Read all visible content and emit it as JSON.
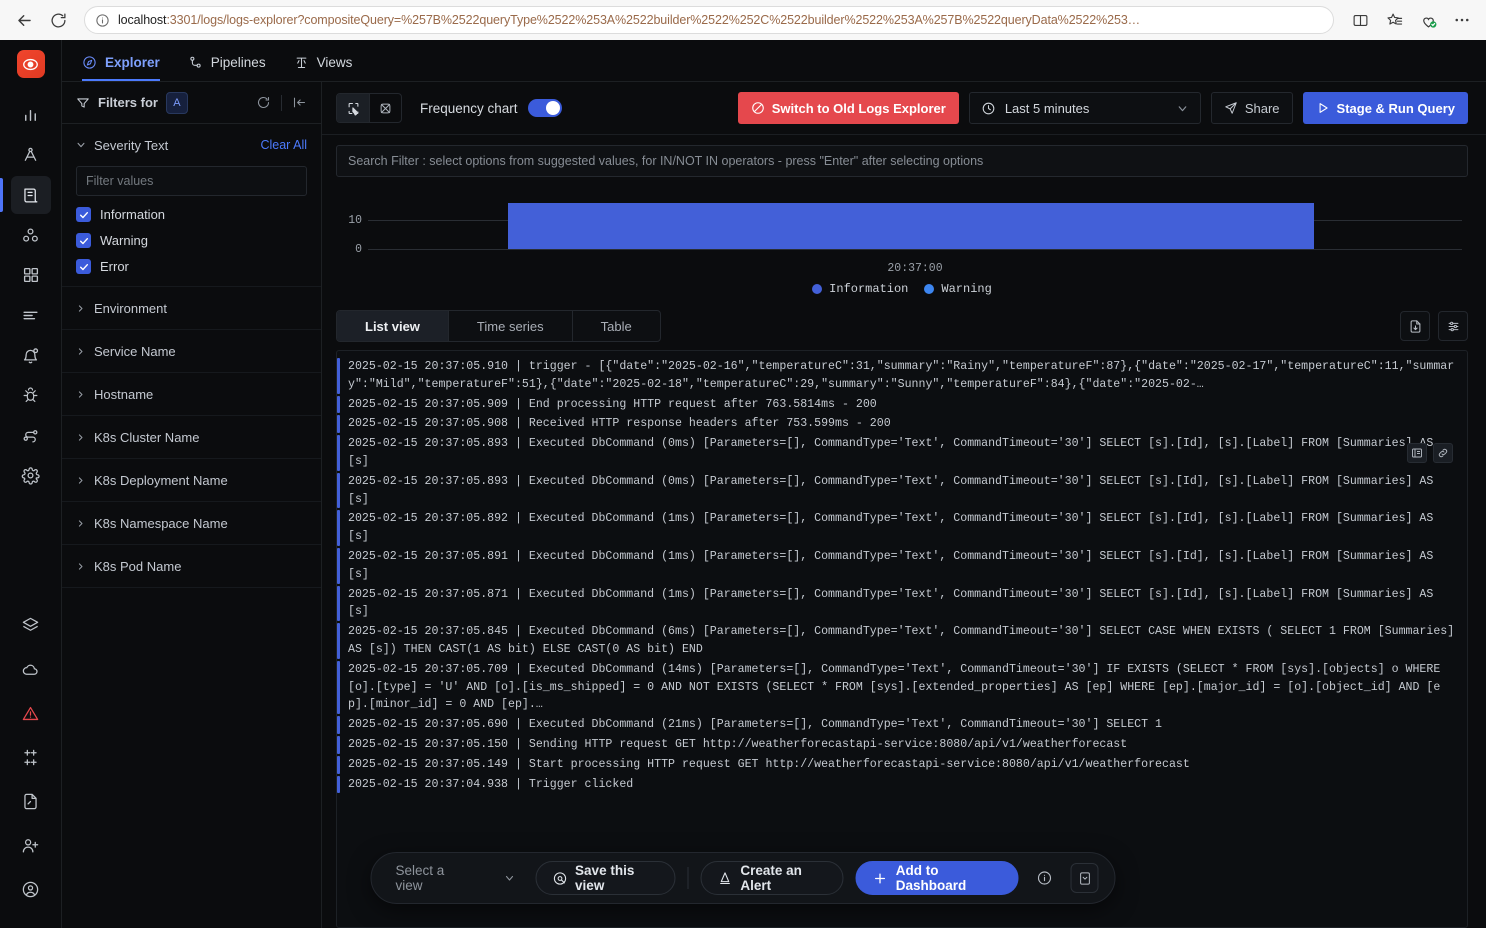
{
  "browser": {
    "back_icon": "back-arrow-icon",
    "reload_icon": "reload-icon",
    "url_host": "localhost",
    "url_rest": ":3301/logs/logs-explorer?compositeQuery=%257B%2522queryType%2522%253A%2522builder%2522%252C%2522builder%2522%253A%257B%2522queryData%2522%253…",
    "actions": [
      "split-screen-icon",
      "favorites-icon",
      "collections-icon",
      "more-icon"
    ]
  },
  "rail": {
    "logo_name": "signoz-logo",
    "items": [
      {
        "name": "services-icon",
        "active": false
      },
      {
        "name": "traces-icon",
        "active": false
      },
      {
        "name": "logs-icon",
        "active": true
      },
      {
        "name": "service-map-icon",
        "active": false
      },
      {
        "name": "dashboards-icon",
        "active": false
      },
      {
        "name": "messaging-queues-icon",
        "active": false
      },
      {
        "name": "alerts-icon",
        "active": false
      },
      {
        "name": "exceptions-icon",
        "active": false
      },
      {
        "name": "pipelines-icon",
        "active": false
      },
      {
        "name": "settings-icon",
        "active": false
      }
    ],
    "bottom_items": [
      {
        "name": "integrations-icon"
      },
      {
        "name": "cloud-icon"
      },
      {
        "name": "warning-icon"
      },
      {
        "name": "slack-icon"
      },
      {
        "name": "docs-icon"
      },
      {
        "name": "invite-member-icon"
      },
      {
        "name": "account-icon"
      }
    ]
  },
  "nav": {
    "tabs": [
      {
        "label": "Explorer",
        "icon": "explorer-icon",
        "active": true
      },
      {
        "label": "Pipelines",
        "icon": "pipelines-icon",
        "active": false
      },
      {
        "label": "Views",
        "icon": "views-icon",
        "active": false
      }
    ]
  },
  "filters": {
    "header_label": "Filters for",
    "query_chip": "A",
    "refresh_icon": "refresh-icon",
    "collapse_icon": "collapse-panel-icon",
    "severity": {
      "title": "Severity Text",
      "clear_all": "Clear All",
      "input_placeholder": "Filter values",
      "input_value": "",
      "options": [
        {
          "label": "Information",
          "checked": true
        },
        {
          "label": "Warning",
          "checked": true
        },
        {
          "label": "Error",
          "checked": true
        }
      ]
    },
    "collapsed_sections": [
      "Environment",
      "Service Name",
      "Hostname",
      "K8s Cluster Name",
      "K8s Deployment Name",
      "K8s Namespace Name",
      "K8s Pod Name"
    ]
  },
  "toolbar": {
    "view_mode_icons": [
      "select-view-icon",
      "raw-view-icon"
    ],
    "frequency_chart_label": "Frequency chart",
    "frequency_chart_on": true,
    "switch_old_label": "Switch to Old Logs Explorer",
    "switch_old_color": "#e5484d",
    "time_range": "Last 5 minutes",
    "share_label": "Share",
    "stage_run_label": "Stage & Run Query",
    "stage_run_color": "#3b5bdb"
  },
  "search": {
    "placeholder": "Search Filter : select options from suggested values, for IN/NOT IN operators - press \"Enter\" after selecting options",
    "value": ""
  },
  "chart_data": {
    "type": "bar",
    "title": "",
    "xlabel": "",
    "ylabel": "",
    "categories": [
      "20:37:00"
    ],
    "x": [
      "20:37:00"
    ],
    "series": [
      {
        "name": "Information",
        "values": [
          13
        ],
        "color": "#4360d8"
      },
      {
        "name": "Warning",
        "values": [
          0
        ],
        "color": "#3d86f0"
      }
    ],
    "ytick_labels": [
      "10",
      "0"
    ],
    "ylim": [
      0,
      13
    ],
    "grid": true,
    "legend_position": "bottom",
    "stacked": true
  },
  "views": {
    "tabs": [
      {
        "label": "List view",
        "active": true
      },
      {
        "label": "Time series",
        "active": false
      },
      {
        "label": "Table",
        "active": false
      }
    ],
    "right_buttons": [
      "download-icon",
      "options-icon"
    ]
  },
  "logs": {
    "hover_actions": [
      "log-details-icon",
      "copy-link-icon"
    ],
    "rows": [
      {
        "ts": "2025-02-15 20:37:05.910",
        "body": "trigger - [{\"date\":\"2025-02-16\",\"temperatureC\":31,\"summary\":\"Rainy\",\"temperatureF\":87},{\"date\":\"2025-02-17\",\"temperatureC\":11,\"summary\":\"Mild\",\"temperatureF\":51},{\"date\":\"2025-02-18\",\"temperatureC\":29,\"summary\":\"Sunny\",\"temperatureF\":84},{\"date\":\"2025-02-…"
      },
      {
        "ts": "2025-02-15 20:37:05.909",
        "body": "End processing HTTP request after 763.5814ms - 200"
      },
      {
        "ts": "2025-02-15 20:37:05.908",
        "body": "Received HTTP response headers after 753.599ms - 200"
      },
      {
        "ts": "2025-02-15 20:37:05.893",
        "body": "Executed DbCommand (0ms) [Parameters=[], CommandType='Text', CommandTimeout='30'] SELECT [s].[Id], [s].[Label] FROM [Summaries] AS [s]"
      },
      {
        "ts": "2025-02-15 20:37:05.893",
        "body": "Executed DbCommand (0ms) [Parameters=[], CommandType='Text', CommandTimeout='30'] SELECT [s].[Id], [s].[Label] FROM [Summaries] AS [s]"
      },
      {
        "ts": "2025-02-15 20:37:05.892",
        "body": "Executed DbCommand (1ms) [Parameters=[], CommandType='Text', CommandTimeout='30'] SELECT [s].[Id], [s].[Label] FROM [Summaries] AS [s]"
      },
      {
        "ts": "2025-02-15 20:37:05.891",
        "body": "Executed DbCommand (1ms) [Parameters=[], CommandType='Text', CommandTimeout='30'] SELECT [s].[Id], [s].[Label] FROM [Summaries] AS [s]"
      },
      {
        "ts": "2025-02-15 20:37:05.871",
        "body": "Executed DbCommand (1ms) [Parameters=[], CommandType='Text', CommandTimeout='30'] SELECT [s].[Id], [s].[Label] FROM [Summaries] AS [s]"
      },
      {
        "ts": "2025-02-15 20:37:05.845",
        "body": "Executed DbCommand (6ms) [Parameters=[], CommandType='Text', CommandTimeout='30'] SELECT CASE WHEN EXISTS ( SELECT 1 FROM [Summaries] AS [s]) THEN CAST(1 AS bit) ELSE CAST(0 AS bit) END"
      },
      {
        "ts": "2025-02-15 20:37:05.709",
        "body": "Executed DbCommand (14ms) [Parameters=[], CommandType='Text', CommandTimeout='30'] IF EXISTS (SELECT * FROM [sys].[objects] o WHERE [o].[type] = 'U' AND [o].[is_ms_shipped] = 0 AND NOT EXISTS (SELECT * FROM [sys].[extended_properties] AS [ep] WHERE [ep].[major_id] = [o].[object_id] AND [ep].[minor_id] = 0 AND [ep].…"
      },
      {
        "ts": "2025-02-15 20:37:05.690",
        "body": "Executed DbCommand (21ms) [Parameters=[], CommandType='Text', CommandTimeout='30'] SELECT 1"
      },
      {
        "ts": "2025-02-15 20:37:05.150",
        "body": "Sending HTTP request GET http://weatherforecastapi-service:8080/api/v1/weatherforecast"
      },
      {
        "ts": "2025-02-15 20:37:05.149",
        "body": "Start processing HTTP request GET http://weatherforecastapi-service:8080/api/v1/weatherforecast"
      },
      {
        "ts": "2025-02-15 20:37:04.938",
        "body": "Trigger clicked"
      }
    ]
  },
  "action_bar": {
    "select_view_placeholder": "Select a view",
    "save_view_label": "Save this view",
    "create_alert_label": "Create an Alert",
    "add_dashboard_label": "Add to Dashboard",
    "info_icon": "info-icon",
    "feedback_icon": "feedback-icon"
  }
}
